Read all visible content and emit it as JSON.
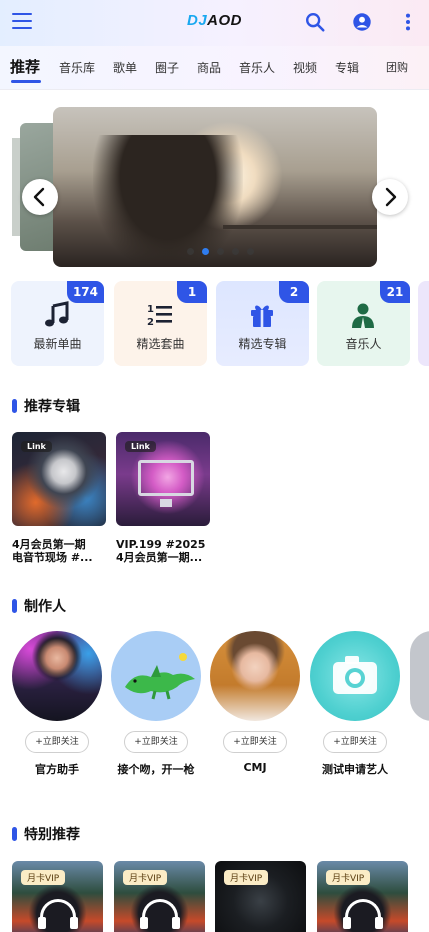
{
  "header": {
    "logo_dj": "DJ",
    "logo_aod": "AOD",
    "menu_icon": "hamburger-menu-icon",
    "search_icon": "search-icon",
    "user_icon": "user-account-icon",
    "more_icon": "more-vertical-icon",
    "accent": "#2f55e6"
  },
  "tabs": [
    {
      "label": "推荐",
      "active": true
    },
    {
      "label": "音乐库"
    },
    {
      "label": "歌单"
    },
    {
      "label": "圈子"
    },
    {
      "label": "商品"
    },
    {
      "label": "音乐人"
    },
    {
      "label": "视频"
    },
    {
      "label": "专辑"
    },
    {
      "label": "团购"
    }
  ],
  "carousel": {
    "slides_indicator": 5,
    "active_index": 1,
    "prev_icon": "chevron-left-icon",
    "next_icon": "chevron-right-icon"
  },
  "categories": [
    {
      "label": "最新单曲",
      "count": "174",
      "icon": "music-note-icon",
      "bg": "#eef3fd"
    },
    {
      "label": "精选套曲",
      "count": "1",
      "icon": "list-numbered-icon",
      "bg": "#fdf3ea"
    },
    {
      "label": "精选专辑",
      "count": "2",
      "icon": "gift-icon",
      "bg": "#dfe8ff"
    },
    {
      "label": "音乐人",
      "count": "21",
      "icon": "person-icon",
      "bg": "#e7f6ee"
    }
  ],
  "albums_section": {
    "title": "推荐专辑",
    "items": [
      {
        "tag": "Link",
        "title_line1": "4月会员第一期",
        "title_line2": "电音节现场 #..."
      },
      {
        "tag": "Link",
        "title_line1": "VIP.199 #2025",
        "title_line2": "4月会员第一期..."
      }
    ]
  },
  "producers_section": {
    "title": "制作人",
    "follow_label": "+立即关注",
    "items": [
      {
        "name": "官方助手"
      },
      {
        "name": "接个吻，开一枪"
      },
      {
        "name": "CMJ"
      },
      {
        "name": "测试申请艺人"
      }
    ]
  },
  "special_section": {
    "title": "特别推荐",
    "items": [
      {
        "tag": "月卡VIP"
      },
      {
        "tag": "月卡VIP"
      },
      {
        "tag": "月卡VIP"
      },
      {
        "tag": "月卡VIP"
      }
    ]
  }
}
